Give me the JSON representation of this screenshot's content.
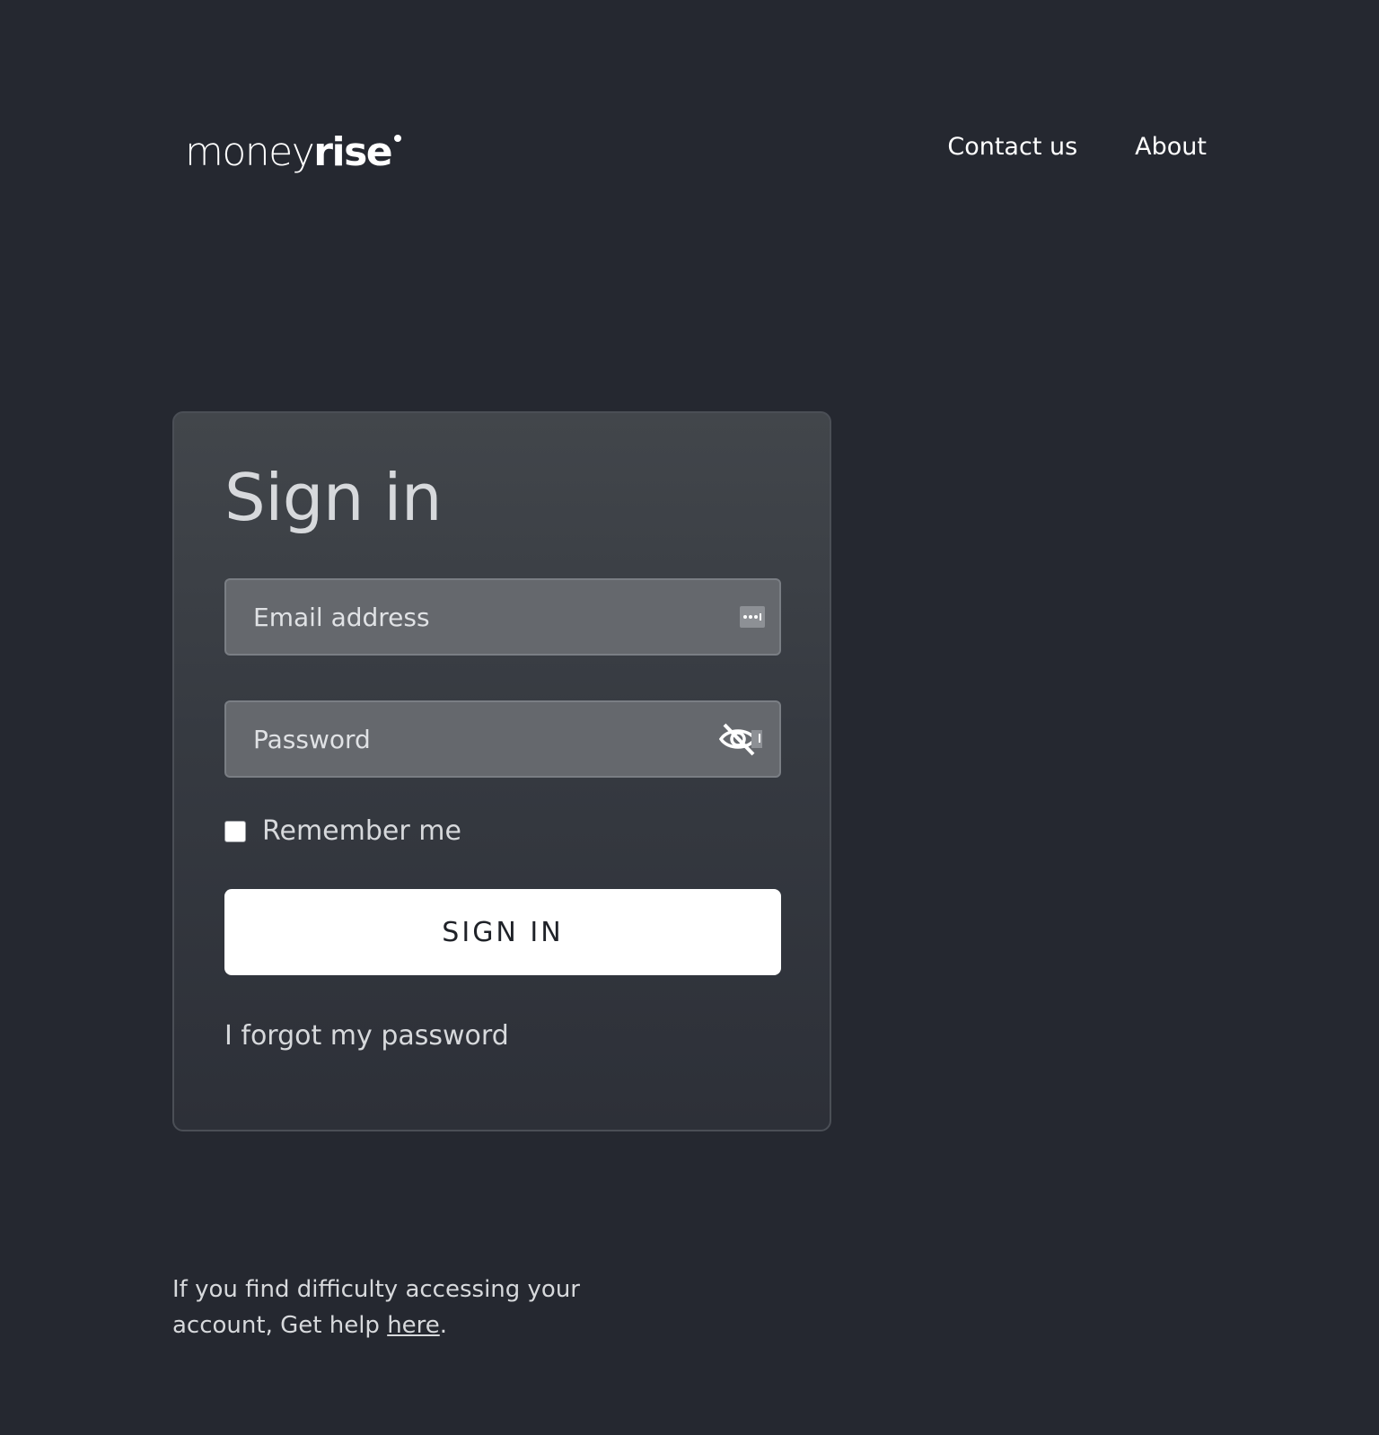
{
  "header": {
    "logo_light": "money",
    "logo_bold": "rise",
    "nav": {
      "contact": "Contact us",
      "about": "About"
    }
  },
  "signin": {
    "title": "Sign in",
    "email_placeholder": "Email address",
    "password_placeholder": "Password",
    "remember_label": "Remember me",
    "remember_checked": false,
    "button_label": "SIGN IN",
    "forgot_label": "I forgot my password"
  },
  "help": {
    "text": "If you find difficulty accessing your account, Get help ",
    "link": "here",
    "suffix": "."
  },
  "colors": {
    "background": "#252830",
    "card_border": "#4b4f56",
    "field_bg": "#65686d",
    "button_bg": "#ffffff",
    "button_text": "#1f2228"
  },
  "icons": {
    "email_field": "password-manager-icon",
    "password_field": "eye-slash-icon"
  }
}
